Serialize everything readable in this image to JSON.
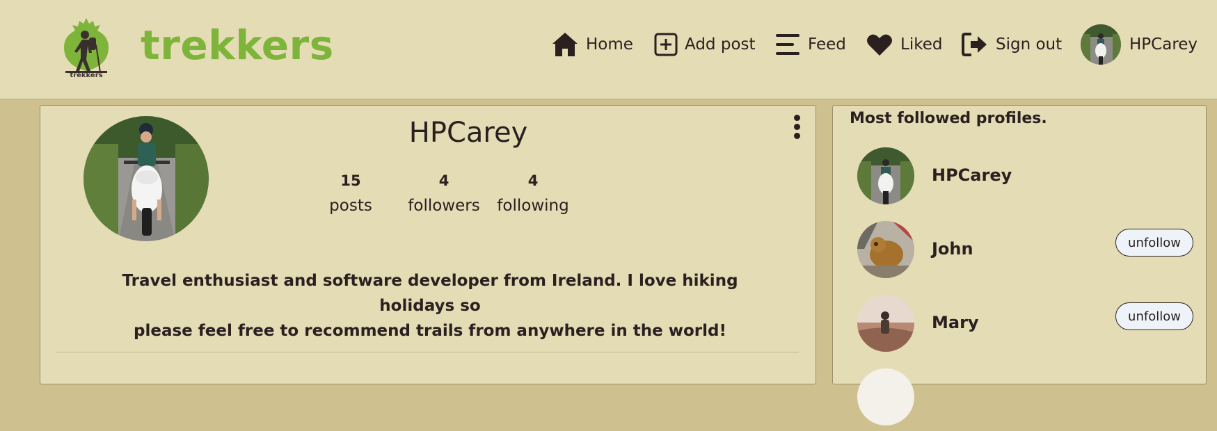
{
  "app": {
    "brand_name": "trekkers",
    "logo_caption": "trekkers",
    "brand_color": "#7fb43a",
    "header_bg": "#e4dcb5",
    "page_bg": "#cfc08f"
  },
  "nav": {
    "items": [
      {
        "label": "Home",
        "icon": "home-icon"
      },
      {
        "label": "Add post",
        "icon": "plus-square-icon"
      },
      {
        "label": "Feed",
        "icon": "bars-icon"
      },
      {
        "label": "Liked",
        "icon": "heart-icon"
      },
      {
        "label": "Sign out",
        "icon": "sign-out-icon"
      }
    ],
    "user": {
      "name": "HPCarey"
    }
  },
  "profile": {
    "name": "HPCarey",
    "stats": [
      {
        "value": "15",
        "label": "posts"
      },
      {
        "value": "4",
        "label": "followers"
      },
      {
        "value": "4",
        "label": "following"
      }
    ],
    "bio_line1": "Travel enthusiast and software developer from Ireland. I love hiking holidays so",
    "bio_line2": "please feel free to recommend trails from anywhere in the world!"
  },
  "sidebar": {
    "title": "Most followed profiles.",
    "profiles": [
      {
        "name": "HPCarey",
        "button": ""
      },
      {
        "name": "John",
        "button": "unfollow"
      },
      {
        "name": "Mary",
        "button": "unfollow"
      }
    ]
  }
}
